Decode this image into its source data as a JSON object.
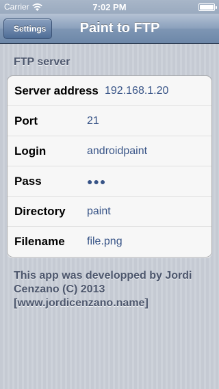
{
  "status_bar": {
    "carrier": "Carrier",
    "time": "7:02 PM",
    "battery_level": 1.0
  },
  "nav": {
    "back_label": "Settings",
    "title": "Paint to FTP"
  },
  "section": {
    "header": "FTP server",
    "rows": [
      {
        "label": "Server address",
        "value": "192.168.1.20"
      },
      {
        "label": "Port",
        "value": "21"
      },
      {
        "label": "Login",
        "value": "androidpaint"
      },
      {
        "label": "Pass",
        "value": "●●●"
      },
      {
        "label": "Directory",
        "value": "paint"
      },
      {
        "label": "Filename",
        "value": "file.png"
      }
    ]
  },
  "footer": {
    "text": "This app was developped by Jordi Cenzano (C) 2013 [www.jordicenzano.name]"
  },
  "colors": {
    "value_text": "#385487",
    "section_text": "#4c566c",
    "nav_bar": "#6d87a8"
  },
  "icons": [
    "wifi-icon",
    "battery-icon"
  ]
}
